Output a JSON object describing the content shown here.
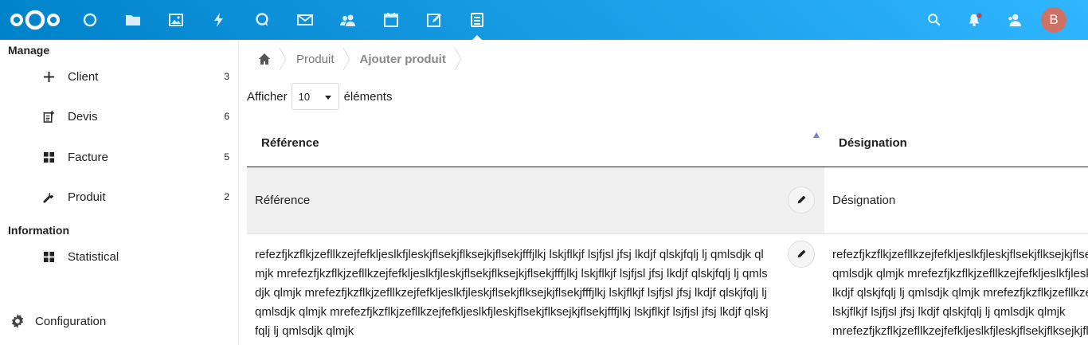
{
  "header": {
    "logo": "nextcloud-logo",
    "apps": [
      "dashboard-icon",
      "files-icon",
      "photos-icon",
      "activity-icon",
      "talk-icon",
      "mail-icon",
      "contacts-icon",
      "calendar-icon",
      "notes-icon",
      "gestion-icon"
    ],
    "right": [
      "search-icon",
      "notifications-icon",
      "contacts-menu-icon"
    ],
    "avatar_initial": "B"
  },
  "sidebar": {
    "manage_title": "Manage",
    "items": [
      {
        "label": "Client",
        "count": "3",
        "icon": "plus-icon"
      },
      {
        "label": "Devis",
        "count": "6",
        "icon": "quote-icon"
      },
      {
        "label": "Facture",
        "count": "5",
        "icon": "grid-icon"
      },
      {
        "label": "Produit",
        "count": "2",
        "icon": "wrench-icon"
      }
    ],
    "information_title": "Information",
    "info_items": [
      {
        "label": "Statistical",
        "icon": "grid-icon"
      }
    ],
    "configuration_label": "Configuration"
  },
  "breadcrumb": {
    "items": [
      "Produit",
      "Ajouter produit"
    ]
  },
  "table_controls": {
    "show_label": "Afficher",
    "page_length": "10",
    "elements_label": "éléments"
  },
  "table": {
    "columns": [
      "Référence",
      "Désignation"
    ],
    "rows": [
      {
        "reference": "Référence",
        "designation": "Désignation"
      },
      {
        "reference": "refezfjkzflkjzefllkzejfefkljeslkfjleskjflsekjflksejkjflsekjfffjlkj lskjflkjf lsjfjsl jfsj lkdjf qlskjfqlj lj qmlsdjk qlmjk mrefezfjkzflkjzefllkzejfefkljeslkfjleskjflsekjflksejkjflsekjfffjlkj lskjflkjf lsjfjsl jfsj lkdjf qlskjfqlj lj qmlsdjk qlmjk mrefezfjkzflkjzefllkzejfefkljeslkfjleskjflsekjflksejkjflsekjfffjlkj lskjflkjf lsjfjsl jfsj lkdjf qlskjfqlj lj qmlsdjk qlmjk mrefezfjkzflkjzefllkzejfefkljeslkfjleskjflsekjflksejkjflsekjfffjlkj lskjflkjf lsjfjsl jfsj lkdjf qlskjfqlj lj qmlsdjk qlmjk",
        "designation_lines": [
          "refezfjkzflkjzefllkzejfefkljeslkfjleskjflsekjflksejkjflsekjfffjlkj",
          "qmlsdjk qlmjk mrefezfjkzflkjzefllkzejfefkljeslkfjleskjflsekjflksejkjflsekjfffjlkj",
          "lkdjf qlskjfqlj lj qmlsdjk qlmjk mrefezfjkzflkjzefllkzejfefkljeslkfjleskjflsekjflksejkjflsekjfffjlkj",
          "lskjflkjf lsjfjsl jfsj lkdjf qlskjfqlj lj qmlsdjk qlmjk",
          "mrefezfjkzflkjzefllkzejfefkljeslkfjleskjflsekjflksejkjflsekjfffjlkj"
        ]
      }
    ]
  }
}
